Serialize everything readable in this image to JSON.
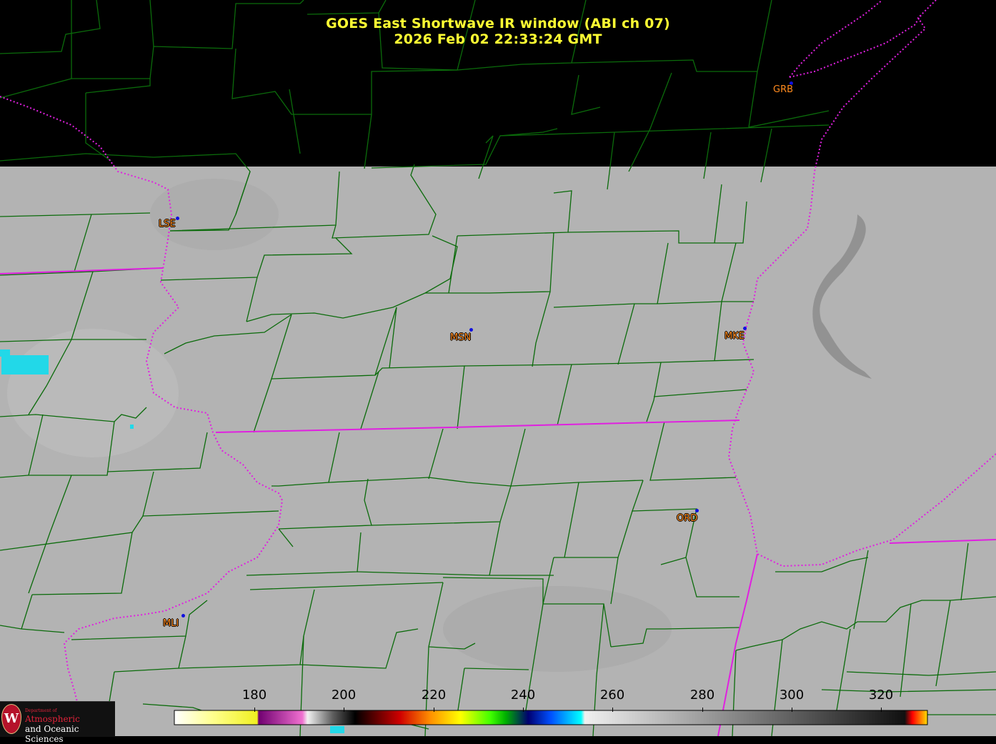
{
  "title": {
    "line1": "GOES East Shortwave IR window (ABI ch 07)",
    "line2": "2026 Feb 02  22:33:24 GMT"
  },
  "stations": [
    {
      "id": "grb",
      "label": "GRB"
    },
    {
      "id": "lse",
      "label": "LSE"
    },
    {
      "id": "msn",
      "label": "MSN"
    },
    {
      "id": "mke",
      "label": "MKE"
    },
    {
      "id": "ord",
      "label": "ORD"
    },
    {
      "id": "mli",
      "label": "MLI"
    }
  ],
  "colorbar": {
    "ticks": [
      "180",
      "200",
      "220",
      "240",
      "260",
      "280",
      "300",
      "320"
    ]
  },
  "logo": {
    "dept": "Department of",
    "line1": "Atmospheric",
    "line2": "and Oceanic Sciences",
    "seal_letter": "W"
  },
  "colors": {
    "title": "#ffff33",
    "station_label": "#ff8a1e",
    "station_dot": "#1010e0",
    "county_lines": "#0b6b0b",
    "state_lines": "#e020e0",
    "land_gray": "#b4b4b4",
    "cold_cloud": "#22d8e8"
  }
}
